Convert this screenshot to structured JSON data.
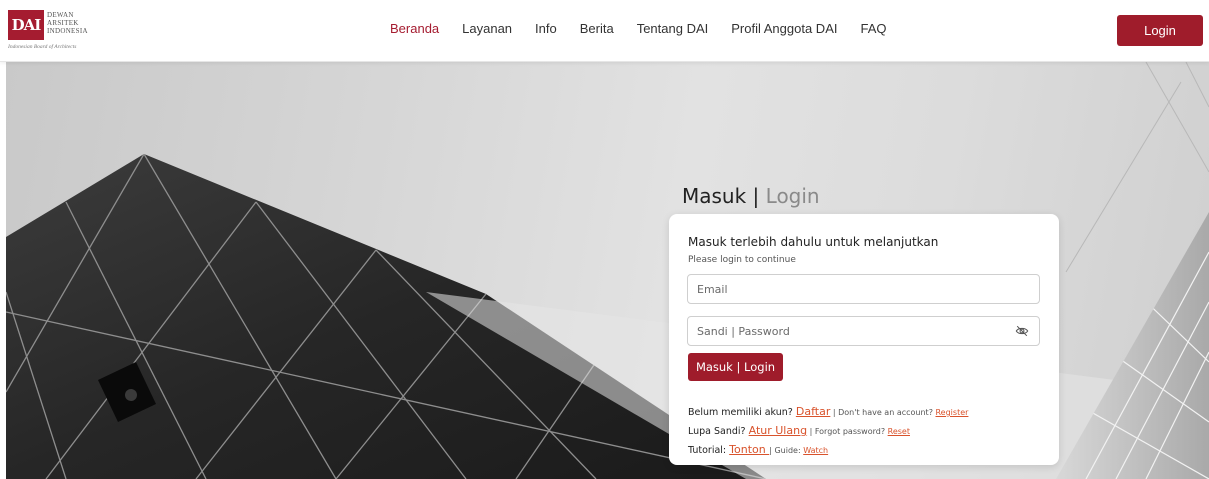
{
  "header": {
    "logo": {
      "mark": "DAI",
      "lines": [
        "DEWAN",
        "ARSITEK",
        "INDONESIA"
      ],
      "tagline": "Indonesian Board of Architects"
    },
    "nav": [
      {
        "label": "Beranda",
        "active": true
      },
      {
        "label": "Layanan",
        "active": false
      },
      {
        "label": "Info",
        "active": false
      },
      {
        "label": "Berita",
        "active": false
      },
      {
        "label": "Tentang DAI",
        "active": false
      },
      {
        "label": "Profil Anggota DAI",
        "active": false
      },
      {
        "label": "FAQ",
        "active": false
      }
    ],
    "login_button": "Login"
  },
  "login": {
    "heading_main": "Masuk |",
    "heading_light": " Login",
    "title": "Masuk terlebih dahulu untuk melanjutkan",
    "subtitle": "Please login to continue",
    "email_placeholder": "Email",
    "password_placeholder": "Sandi | Password",
    "password_toggle_icon": "eye-slash-icon",
    "submit_label": "Masuk | Login",
    "register": {
      "prefix": "Belum memiliki akun? ",
      "link_id": "Daftar",
      "mid": " | Don't have an account? ",
      "link_en": "Register"
    },
    "reset": {
      "prefix": "Lupa Sandi? ",
      "link_id": "Atur Ulang",
      "mid": " | Forgot password? ",
      "link_en": "Reset"
    },
    "tutorial": {
      "prefix": "Tutorial: ",
      "link_id": "Tonton ",
      "mid": "| Guide: ",
      "link_en": "Watch"
    }
  },
  "colors": {
    "brand_red": "#9f1c2b",
    "link_orange": "#d9532c",
    "active_nav": "#a51c30"
  }
}
